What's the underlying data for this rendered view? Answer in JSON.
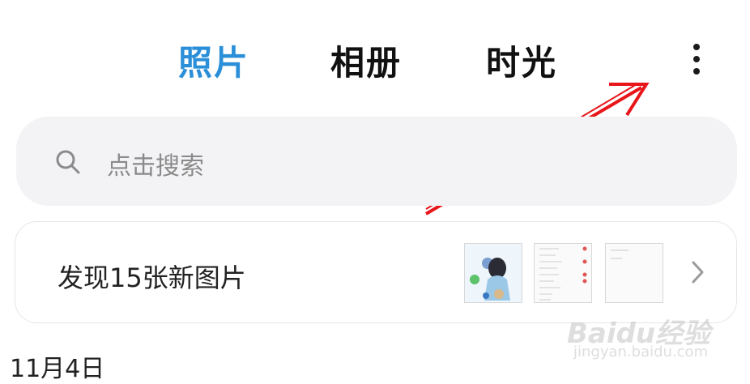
{
  "tabs": [
    {
      "label": "照片",
      "active": true
    },
    {
      "label": "相册",
      "active": false
    },
    {
      "label": "时光",
      "active": false
    }
  ],
  "more_icon": "more-vertical-icon",
  "search": {
    "placeholder": "点击搜索",
    "icon": "search-icon"
  },
  "discover_card": {
    "text": "发现15张新图片",
    "thumbnails": [
      "thumbnail-illustration",
      "thumbnail-settings-screenshot",
      "thumbnail-document-screenshot"
    ]
  },
  "date_header": "11月4日",
  "watermark": {
    "main": "Baidu经验",
    "sub": "jingyan.baidu.com"
  },
  "colors": {
    "accent": "#2a8fd8",
    "annotation_arrow": "#e8151a",
    "search_bg": "#f3f3f5"
  }
}
